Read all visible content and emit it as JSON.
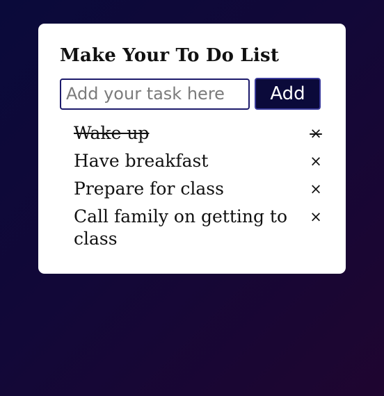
{
  "app": {
    "title": "Make Your To Do List"
  },
  "input": {
    "placeholder": "Add your task here",
    "value": ""
  },
  "add_button": {
    "label": "Add"
  },
  "tasks": [
    {
      "text": "Wake up",
      "done": true,
      "delete_glyph": "×"
    },
    {
      "text": "Have breakfast",
      "done": false,
      "delete_glyph": "×"
    },
    {
      "text": "Prepare for class",
      "done": false,
      "delete_glyph": "×"
    },
    {
      "text": "Call family on getting to class",
      "done": false,
      "delete_glyph": "×"
    }
  ],
  "colors": {
    "background_start": "#0a0a3a",
    "background_end": "#1f0530",
    "card": "#ffffff",
    "button_bg": "#0b0a3a",
    "input_border": "#1c1a6b"
  }
}
